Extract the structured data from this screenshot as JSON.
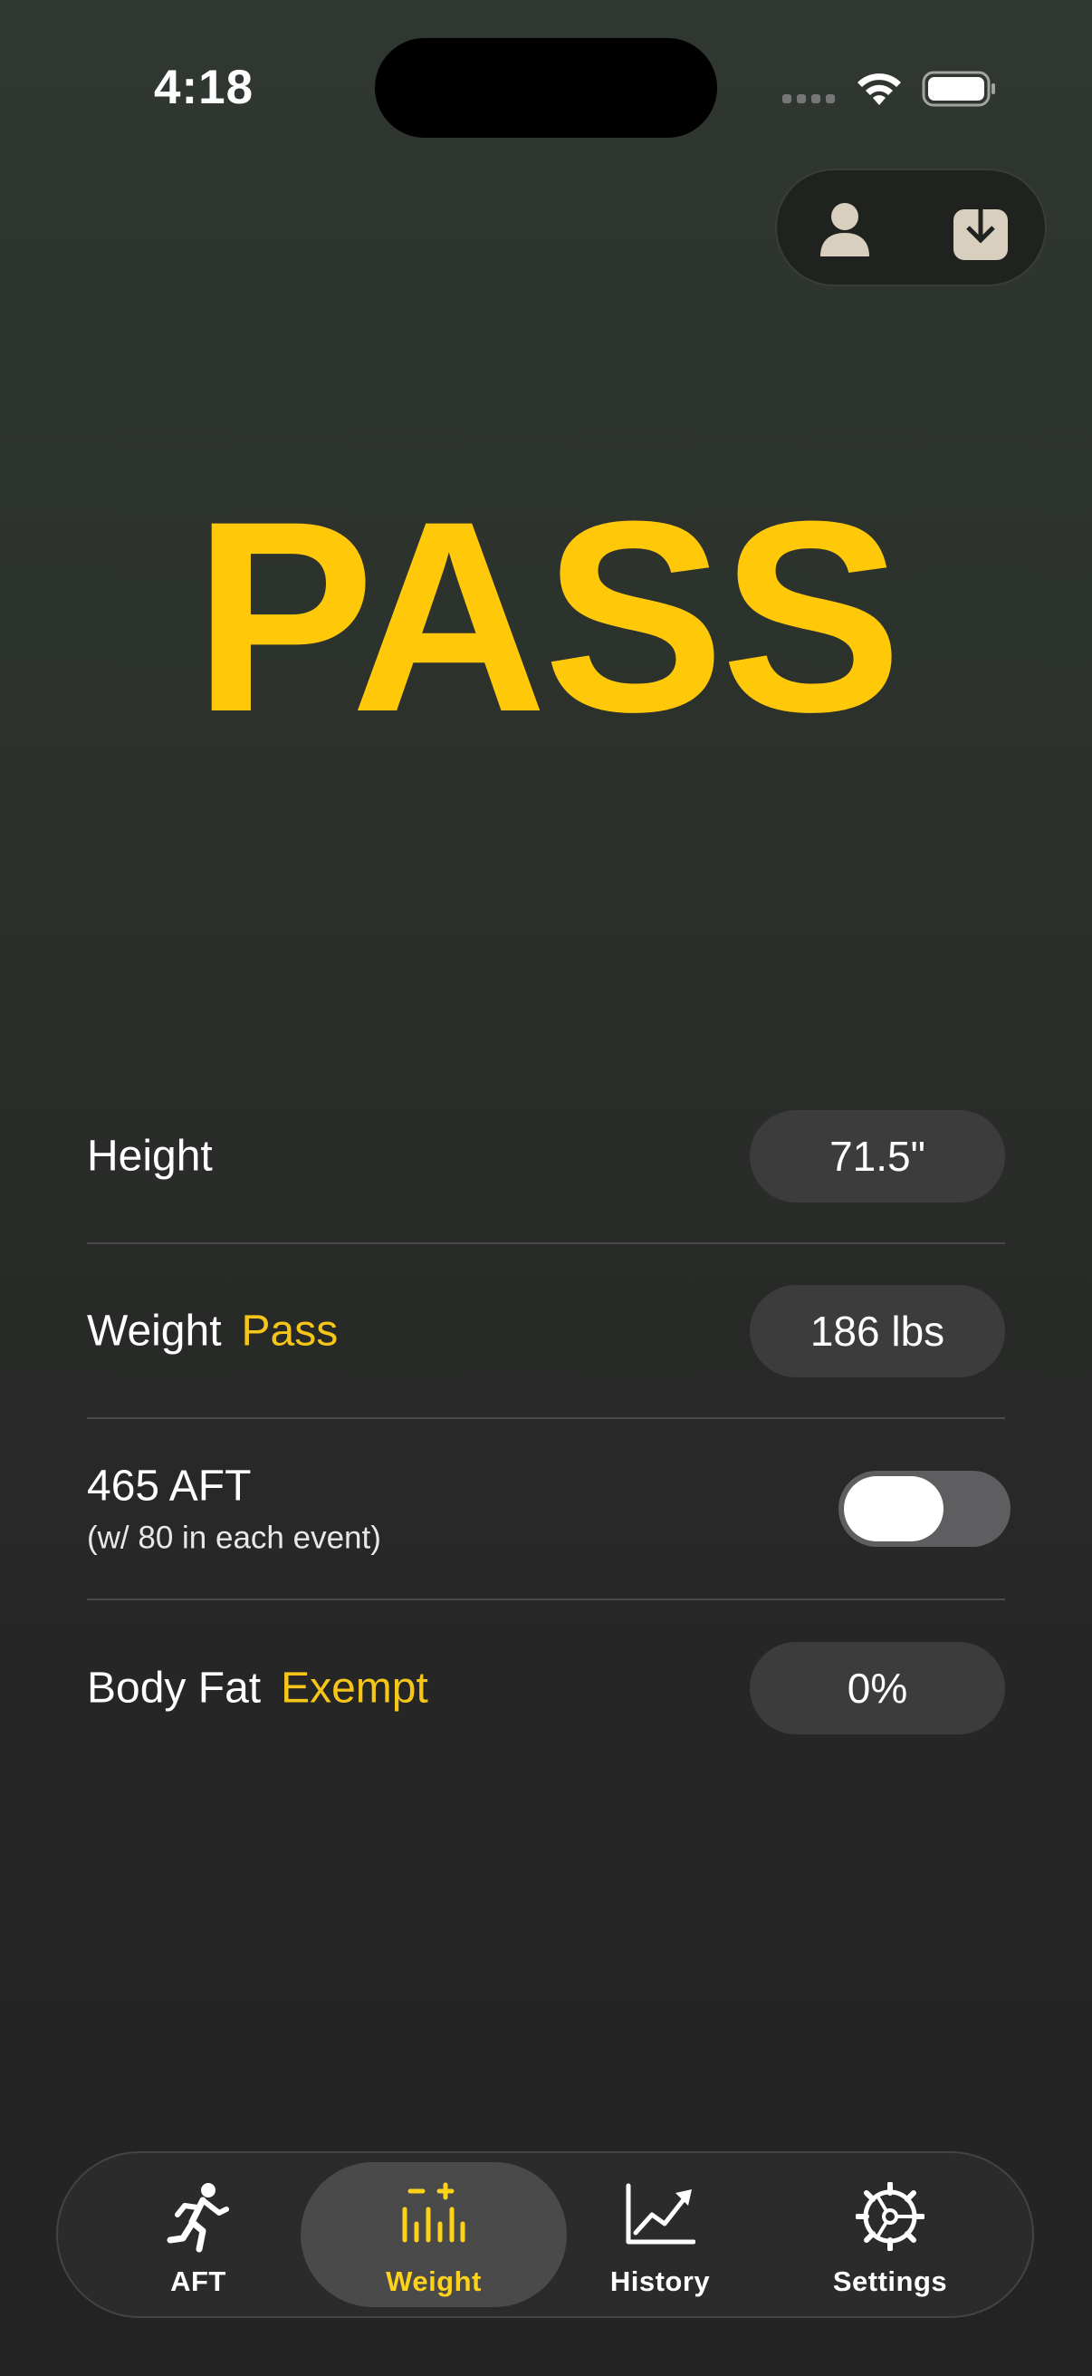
{
  "status_bar": {
    "time": "4:18"
  },
  "top_actions": {
    "profile_icon": "person-icon",
    "export_icon": "download-tray-icon"
  },
  "result": {
    "text": "PASS",
    "color": "#ffc90a"
  },
  "rows": {
    "height": {
      "label": "Height",
      "value": "71.5\""
    },
    "weight": {
      "label": "Weight",
      "status": "Pass",
      "value": "186 lbs"
    },
    "aft": {
      "label": "465 AFT",
      "sublabel": "(w/ 80 in each event)",
      "toggle_on": false
    },
    "body_fat": {
      "label": "Body Fat",
      "status": "Exempt",
      "value": "0%"
    }
  },
  "tabs": [
    {
      "label": "AFT",
      "icon": "running-figure-icon",
      "active": false
    },
    {
      "label": "Weight",
      "icon": "scale-bars-icon",
      "active": true
    },
    {
      "label": "History",
      "icon": "line-chart-icon",
      "active": false
    },
    {
      "label": "Settings",
      "icon": "gear-icon",
      "active": false
    }
  ],
  "colors": {
    "accent": "#ffc90a",
    "status_text": "#f5c518",
    "active_tab": "#ffd21a"
  }
}
